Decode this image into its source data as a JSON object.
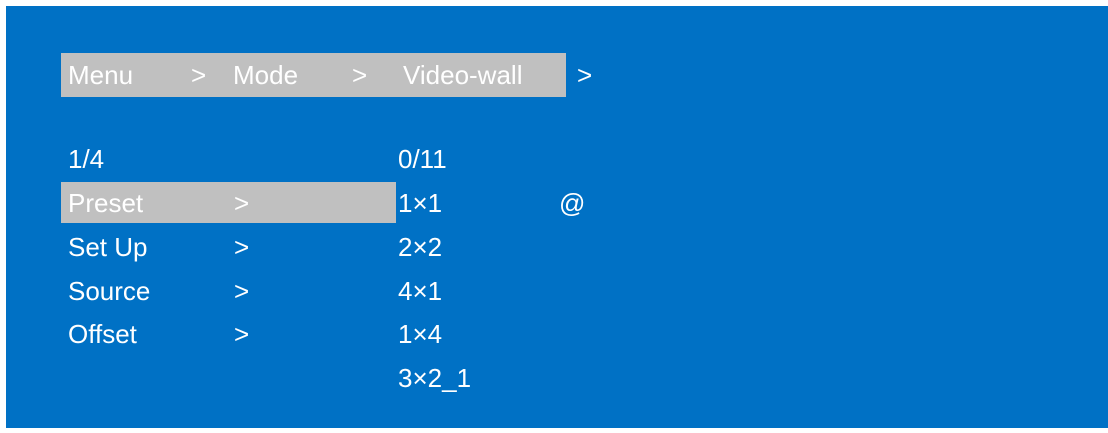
{
  "breadcrumb": {
    "item1": "Menu",
    "sep1": ">",
    "item2": "Mode",
    "sep2": ">",
    "item3": "Video-wall",
    "sep3": ">"
  },
  "menu": {
    "page_indicator": "1/4",
    "items": [
      {
        "label": "Preset",
        "arrow": ">",
        "selected": true
      },
      {
        "label": "Set Up",
        "arrow": ">"
      },
      {
        "label": "Source",
        "arrow": ">"
      },
      {
        "label": "Offset",
        "arrow": ">"
      }
    ]
  },
  "presets": {
    "page_indicator": "0/11",
    "items": [
      "1×1",
      "2×2",
      "4×1",
      "1×4",
      "3×2_1"
    ],
    "active_marker": "@"
  },
  "colors": {
    "background": "#0071c5",
    "highlight": "#c0c0c0",
    "text": "#ffffff"
  }
}
